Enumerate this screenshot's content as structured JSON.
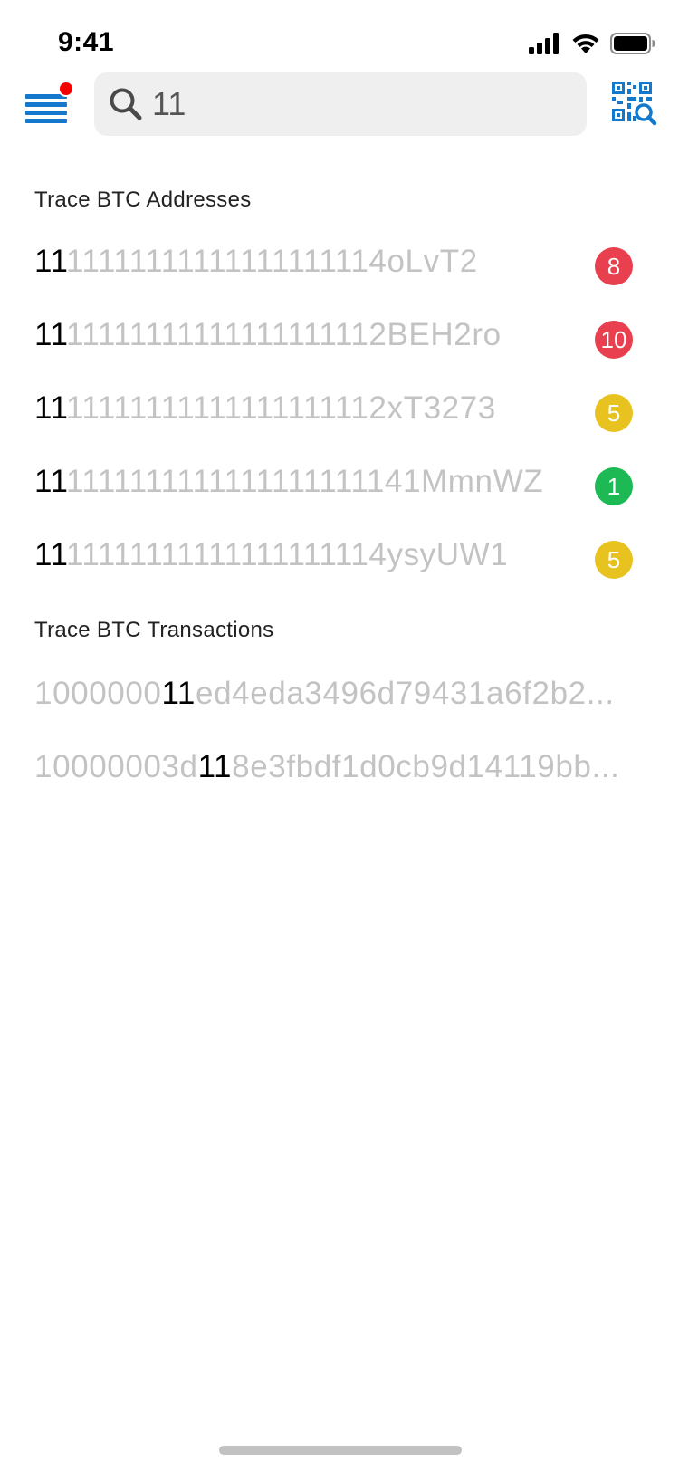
{
  "status_bar": {
    "time": "9:41",
    "icons": [
      "signal-icon",
      "wifi-icon",
      "battery-icon"
    ]
  },
  "header": {
    "menu_icon": "hamburger-menu-icon",
    "notification_dot_color": "#f40000",
    "search": {
      "icon": "search-icon",
      "value": "11",
      "placeholder": ""
    },
    "qr_icon": "qr-code-scan-icon",
    "accent_color": "#1479cc"
  },
  "addresses": {
    "title": "Trace BTC Addresses",
    "items": [
      {
        "prefix": "",
        "match": "11",
        "suffix": "11111111111111111114oLvT2",
        "badge": "8",
        "badge_color": "#e8404f"
      },
      {
        "prefix": "",
        "match": "11",
        "suffix": "11111111111111111112BEH2ro",
        "badge": "10",
        "badge_color": "#e8404f"
      },
      {
        "prefix": "",
        "match": "11",
        "suffix": "11111111111111111112xT3273",
        "badge": "5",
        "badge_color": "#e8c21f"
      },
      {
        "prefix": "",
        "match": "11",
        "suffix": "1111111111111111111141MmnWZ",
        "badge": "1",
        "badge_color": "#1db954"
      },
      {
        "prefix": "",
        "match": "11",
        "suffix": "11111111111111111114ysyUW1",
        "badge": "5",
        "badge_color": "#e8c21f"
      }
    ]
  },
  "transactions": {
    "title": "Trace BTC Transactions",
    "items": [
      {
        "prefix": "1000000",
        "match": "11",
        "suffix": "ed4eda3496d79431a6f2b2..."
      },
      {
        "prefix": "10000003d",
        "match": "11",
        "suffix": "8e3fbdf1d0cb9d14119bb..."
      }
    ]
  }
}
